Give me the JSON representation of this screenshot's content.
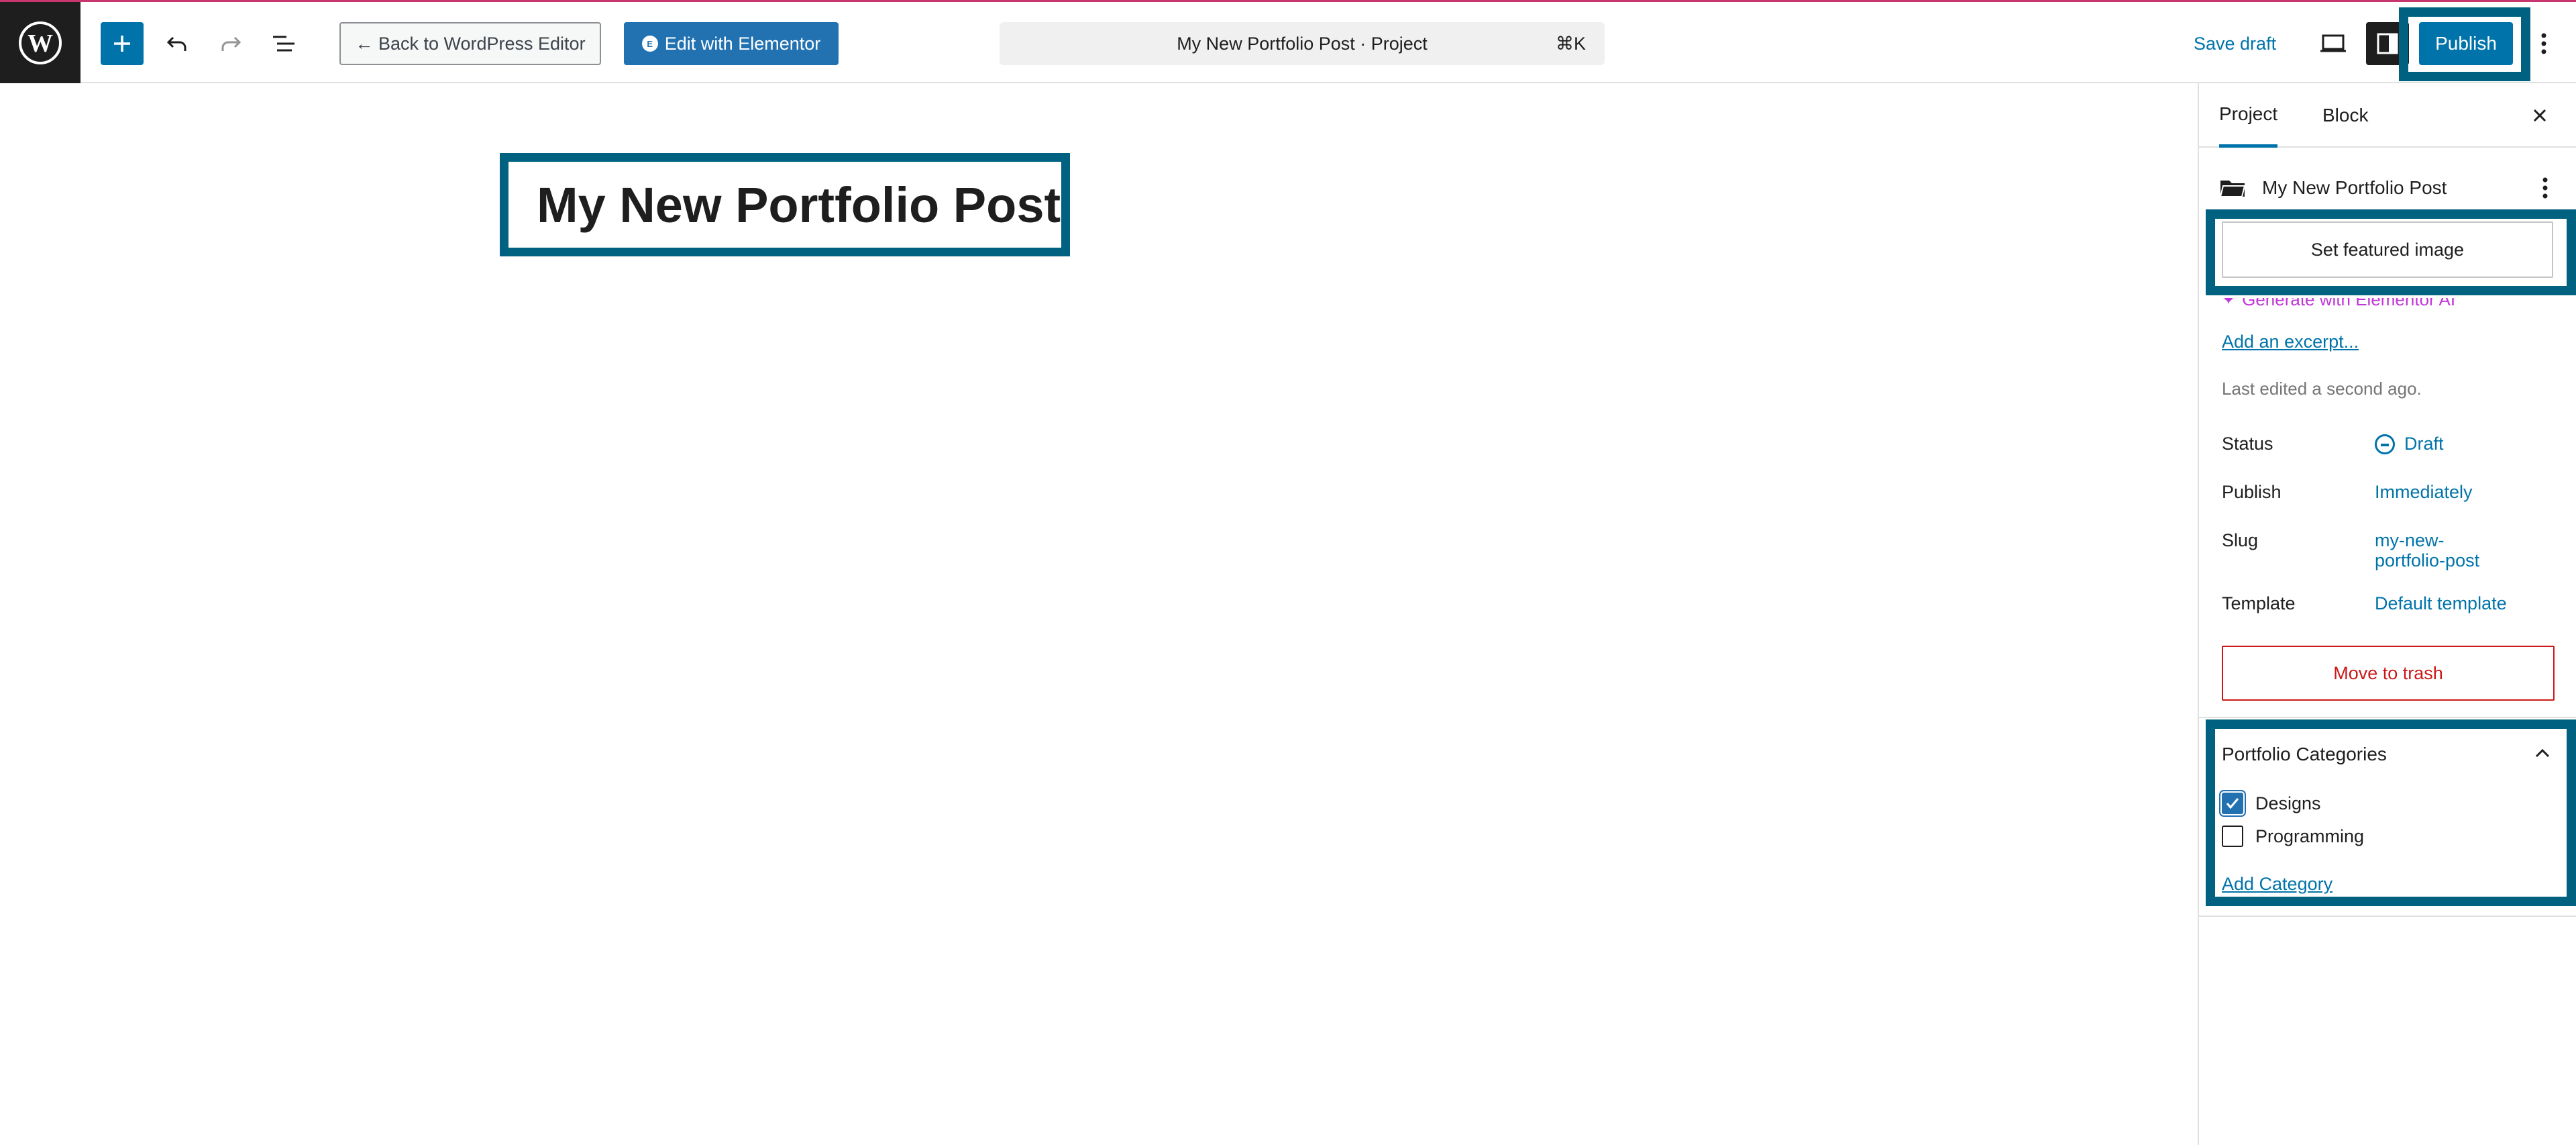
{
  "topbar": {
    "back_label": "← Back to WordPress Editor",
    "elementor_label": "Edit with Elementor",
    "elementor_badge": "E",
    "doc_title": "My New Portfolio Post · Project",
    "shortcut": "⌘K",
    "save_draft": "Save draft",
    "publish": "Publish",
    "icons": [
      "wordpress-logo-icon",
      "plus-icon",
      "undo-icon",
      "redo-icon",
      "list-view-icon",
      "desktop-preview-icon",
      "settings-panel-icon",
      "more-vertical-icon"
    ]
  },
  "editor": {
    "post_title": "My New Portfolio Post"
  },
  "sidebar": {
    "tabs": [
      "Project",
      "Block"
    ],
    "active_tab": "Project",
    "doc_name": "My New Portfolio Post",
    "featured_image": "Set featured image",
    "generate_ai": "Generate with Elementor AI",
    "excerpt": "Add an excerpt...",
    "last_edited": "Last edited a second ago.",
    "properties": [
      {
        "label": "Status",
        "value": "Draft"
      },
      {
        "label": "Publish",
        "value": "Immediately"
      },
      {
        "label": "Slug",
        "value": "my-new-portfolio-post"
      },
      {
        "label": "Template",
        "value": "Default template"
      }
    ],
    "trash": "Move to trash",
    "categories": {
      "heading": "Portfolio Categories",
      "items": [
        {
          "label": "Designs",
          "checked": true
        },
        {
          "label": "Programming",
          "checked": false
        }
      ],
      "add_label": "Add Category"
    }
  },
  "colors": {
    "accent": "#0073aa",
    "highlight_frame": "#006180",
    "danger": "#cc1818",
    "ai": "#c036d6"
  }
}
